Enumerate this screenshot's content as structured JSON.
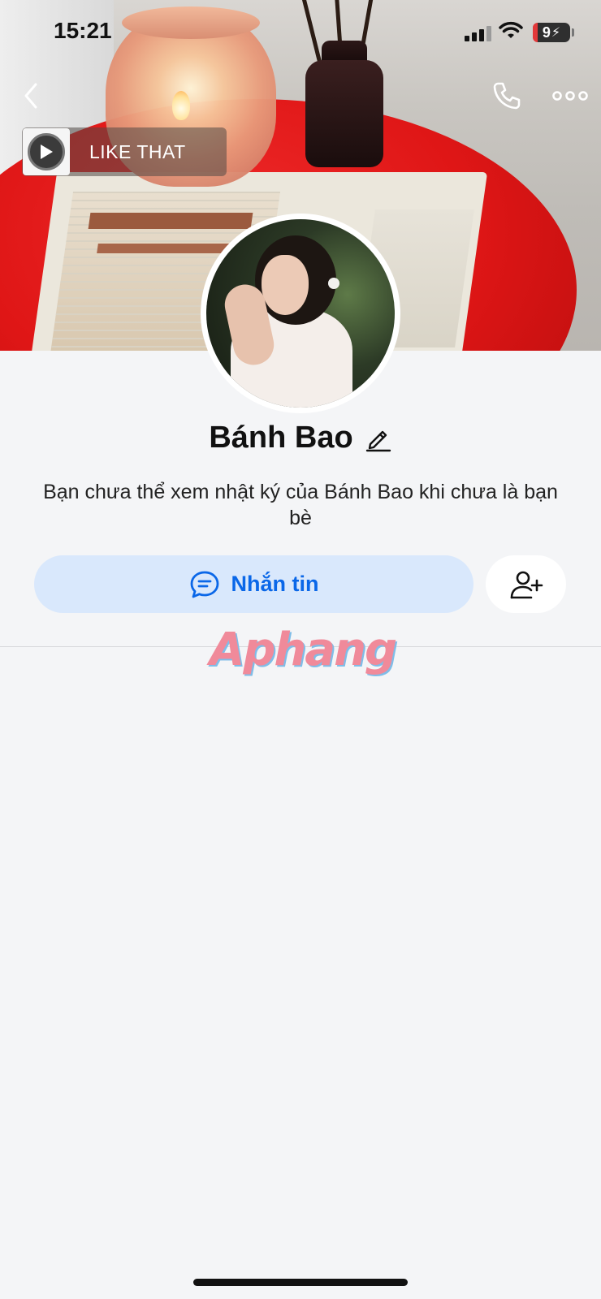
{
  "status_bar": {
    "time": "15:21",
    "battery_level": "9"
  },
  "music": {
    "title": "LIKE THAT"
  },
  "profile": {
    "name": "Bánh Bao",
    "description": "Bạn chưa thể xem nhật ký của Bánh Bao khi chưa là bạn bè"
  },
  "actions": {
    "message_label": "Nhắn tin"
  },
  "watermark": {
    "text": "Aphang"
  },
  "icons": {
    "back": "chevron-left-icon",
    "call": "phone-icon",
    "more": "more-horizontal-icon",
    "edit": "pencil-icon",
    "message": "chat-bubble-icon",
    "add_friend": "add-user-icon"
  },
  "colors": {
    "accent": "#0a67e8",
    "message_button_bg": "#d9e8fc",
    "background": "#f4f5f7",
    "battery_low": "#e3393a"
  }
}
